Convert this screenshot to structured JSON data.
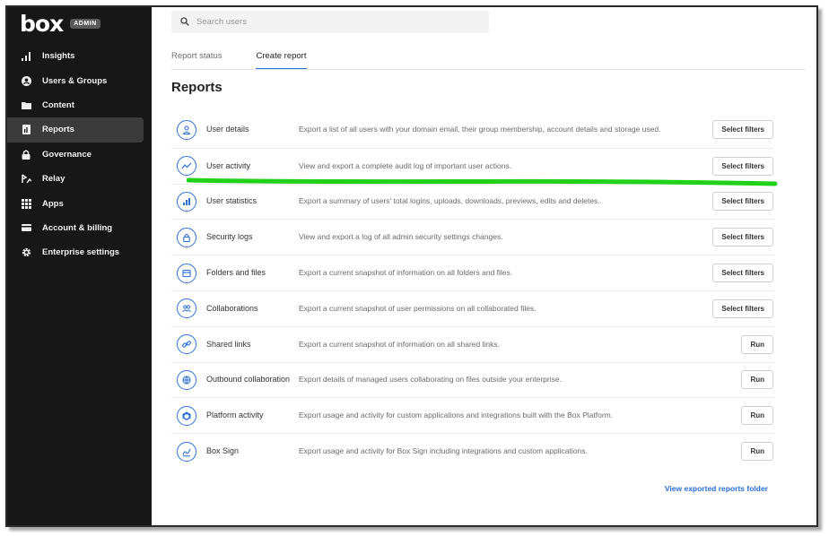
{
  "app": {
    "logo_text": "box",
    "badge": "ADMIN"
  },
  "sidebar": {
    "items": [
      {
        "label": "Insights",
        "icon": "insights-icon"
      },
      {
        "label": "Users & Groups",
        "icon": "user-icon"
      },
      {
        "label": "Content",
        "icon": "folder-icon"
      },
      {
        "label": "Reports",
        "icon": "report-icon",
        "active": true
      },
      {
        "label": "Governance",
        "icon": "lock-icon"
      },
      {
        "label": "Relay",
        "icon": "relay-icon"
      },
      {
        "label": "Apps",
        "icon": "apps-grid-icon"
      },
      {
        "label": "Account & billing",
        "icon": "card-icon"
      },
      {
        "label": "Enterprise settings",
        "icon": "gear-icon"
      }
    ]
  },
  "search": {
    "placeholder": "Search users"
  },
  "tabs": [
    {
      "label": "Report status",
      "active": false
    },
    {
      "label": "Create report",
      "active": true
    }
  ],
  "page": {
    "title": "Reports",
    "view_link": "View exported reports folder"
  },
  "reports": [
    {
      "name": "User details",
      "desc": "Export a list of all users with your domain email, their group membership, account details and storage used.",
      "action": "Select filters",
      "icon": "user-details-icon"
    },
    {
      "name": "User activity",
      "desc": "View and export a complete audit log of important user actions.",
      "action": "Select filters",
      "icon": "activity-icon"
    },
    {
      "name": "User statistics",
      "desc": "Export a summary of users' total logins, uploads, downloads, previews, edits and deletes.",
      "action": "Select filters",
      "icon": "statistics-icon"
    },
    {
      "name": "Security logs",
      "desc": "View and export a log of all admin security settings changes.",
      "action": "Select filters",
      "icon": "security-lock-icon"
    },
    {
      "name": "Folders and files",
      "desc": "Export a current snapshot of information on all folders and files.",
      "action": "Select filters",
      "icon": "folders-icon"
    },
    {
      "name": "Collaborations",
      "desc": "Export a current snapshot of user permissions on all collaborated files.",
      "action": "Select filters",
      "icon": "collaborations-icon"
    },
    {
      "name": "Shared links",
      "desc": "Export a current snapshot of information on all shared links.",
      "action": "Run",
      "icon": "link-icon"
    },
    {
      "name": "Outbound collaboration",
      "desc": "Export details of managed users collaborating on files outside your enterprise.",
      "action": "Run",
      "icon": "outbound-icon"
    },
    {
      "name": "Platform activity",
      "desc": "Export usage and activity for custom applications and integrations built with the Box Platform.",
      "action": "Run",
      "icon": "platform-icon"
    },
    {
      "name": "Box Sign",
      "desc": "Export usage and activity for Box Sign including integrations and custom applications.",
      "action": "Run",
      "icon": "sign-icon"
    }
  ],
  "colors": {
    "sidebar_bg": "#171717",
    "accent": "#2b6fd6",
    "highlight": "#22d11a"
  }
}
